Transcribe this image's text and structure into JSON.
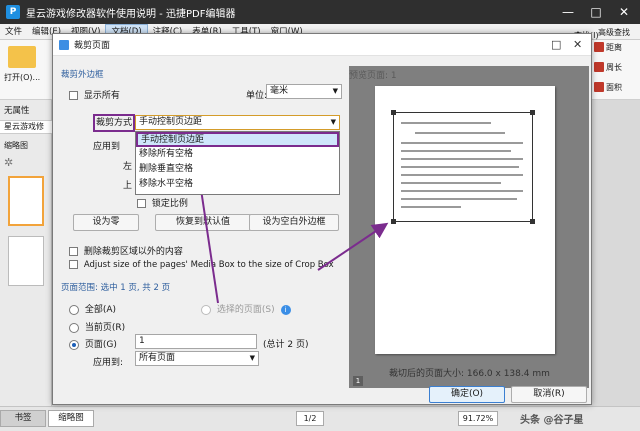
{
  "app": {
    "title": "星云游戏修改器软件使用说明 - 迅捷PDF编辑器",
    "logo": "P",
    "menu": [
      "文件",
      "编辑(E)",
      "视图(V)",
      "文档(D)",
      "注释(C)",
      "表单(R)",
      "工具(T)",
      "窗口(W)"
    ],
    "active_menu_index": 3,
    "ribbon_open_label": "打开(O)...",
    "left_tab_properties": "无属性",
    "left_doc_tab": "星云游戏修",
    "thumbnail_label": "缩略图",
    "right_ribbon": [
      "查找(I)",
      "高级查找",
      "距离",
      "周长",
      "面积"
    ],
    "bottom_tabs": [
      "书签",
      "缩略图"
    ],
    "page_indicator": "1/2",
    "zoom": "91.72%",
    "watermark": "头条 @谷子星"
  },
  "dialog": {
    "title": "裁剪页面",
    "margins_section": "裁剪外边框",
    "show_all_label": "显示所有",
    "unit_label": "单位:",
    "unit_value": "毫米",
    "crop_mode_label": "裁剪方式",
    "crop_mode_value": "手动控制页边距",
    "crop_mode_options": [
      "手动控制页边距",
      "移除所有空格",
      "删除垂直空格",
      "移除水平空格"
    ],
    "apply_to_label": "应用到",
    "left_label": "左",
    "top_label": "上",
    "keep_ratio_label": "锁定比例",
    "set_zero_button": "设为零",
    "restore_button": "恢复到默认值",
    "set_blank_margin_button": "设为空白外边框",
    "delete_outside_label": "删除裁剪区域以外的内容",
    "media_box_label": "Adjust size of the pages' Media Box to the size of Crop Box",
    "page_range_section": "页面范围: 选中 1 页, 共 2 页",
    "all_pages_label": "全部(A)",
    "current_page_label": "当前页(R)",
    "pages_label": "页面(G)",
    "pages_value": "1",
    "pages_total": "(总计 2 页)",
    "selected_pages_label": "选择的页面(S)",
    "apply_to_subset_label": "应用到:",
    "apply_to_subset_value": "所有页面",
    "preview_label": "预览页面: 1",
    "preview_page_number": "1",
    "cropped_size_label": "裁切后的页面大小: 166.0 x 138.4 mm",
    "ok_button": "确定(O)",
    "cancel_button": "取消(R)"
  },
  "colors": {
    "accent": "#1d5fb8",
    "annotation_purple": "#7b2c8e",
    "dropdown_selected": "#cfe6fb",
    "preview_bg": "#7f7f7f"
  }
}
